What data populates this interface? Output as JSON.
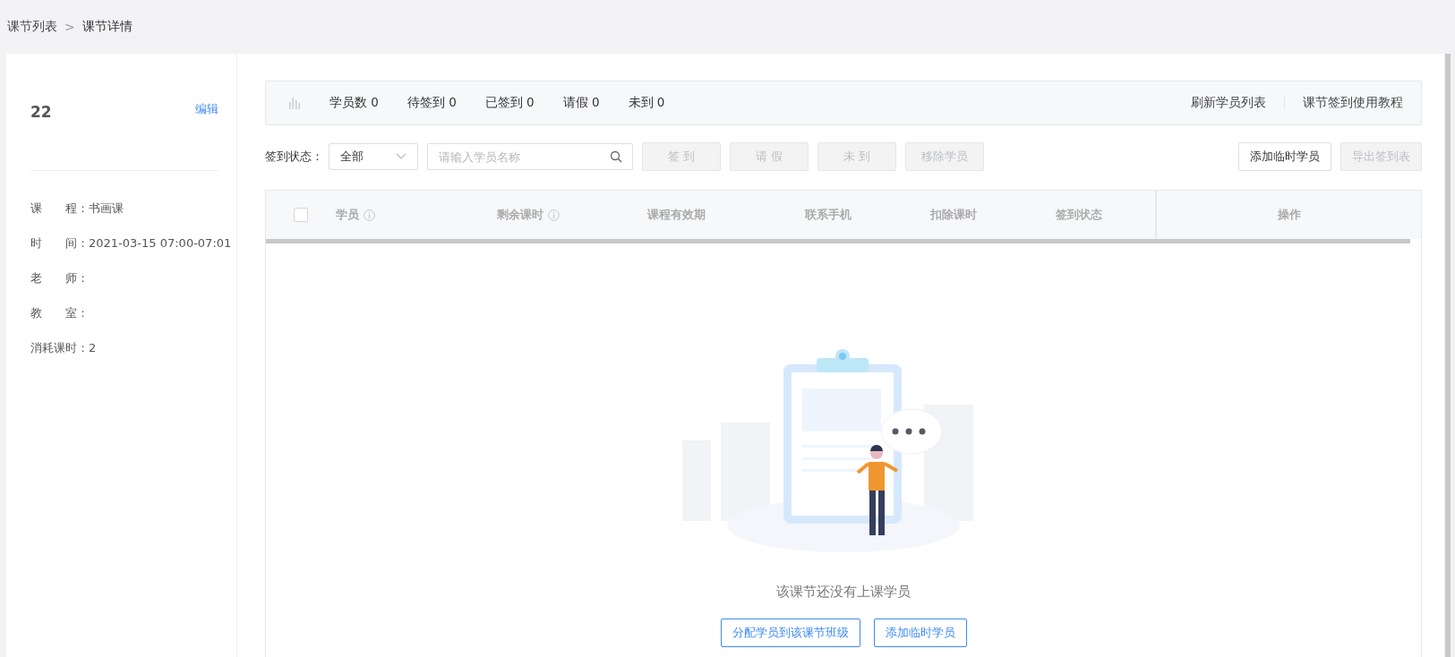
{
  "breadcrumb": {
    "items": [
      {
        "label": "课节列表",
        "current": false
      },
      {
        "label": "课节详情",
        "current": true
      }
    ],
    "separator": ">"
  },
  "lesson": {
    "title": "22",
    "edit_link": "编辑",
    "fields": [
      {
        "label": "课　　程：",
        "value": "书画课"
      },
      {
        "label": "时　　间：",
        "value": "2021-03-15 07:00-07:01"
      },
      {
        "label": "老　　师："
      },
      {
        "label": "教　　室："
      },
      {
        "label": "消耗课时：",
        "value": "2"
      }
    ]
  },
  "stats": {
    "items": [
      {
        "label": "学员数",
        "count": "0"
      },
      {
        "label": "待签到",
        "count": "0"
      },
      {
        "label": "已签到",
        "count": "0"
      },
      {
        "label": "请假",
        "count": "0"
      },
      {
        "label": "未到",
        "count": "0"
      }
    ],
    "links": [
      "刷新学员列表",
      "课节签到使用教程"
    ]
  },
  "filter": {
    "label": "签到状态：",
    "status_select": "全部",
    "search": {
      "placeholder": "请输入学员名称"
    }
  },
  "actions": [
    {
      "label": "签 到",
      "disabled": true
    },
    {
      "label": "请 假",
      "disabled": true
    },
    {
      "label": "未 到",
      "disabled": true
    },
    {
      "label": "移除学员",
      "disabled": true
    }
  ],
  "right_actions": [
    {
      "label": "添加临时学员",
      "disabled": false
    },
    {
      "label": "导出签到表",
      "disabled": true
    }
  ],
  "table": {
    "select_all": {
      "checked": false
    },
    "columns": [
      {
        "label": "学员",
        "info": true
      },
      {
        "label": "剩余课时",
        "info": true
      },
      {
        "label": "课程有效期",
        "info": false
      },
      {
        "label": "联系手机",
        "info": false
      },
      {
        "label": "扣除课时",
        "info": false
      },
      {
        "label": "签到状态",
        "info": false
      },
      {
        "label": "操作",
        "info": false
      }
    ]
  },
  "empty_state": {
    "message": "该课节还没有上课学员",
    "buttons": [
      "分配学员到该课节班级",
      "添加临时学员"
    ]
  }
}
